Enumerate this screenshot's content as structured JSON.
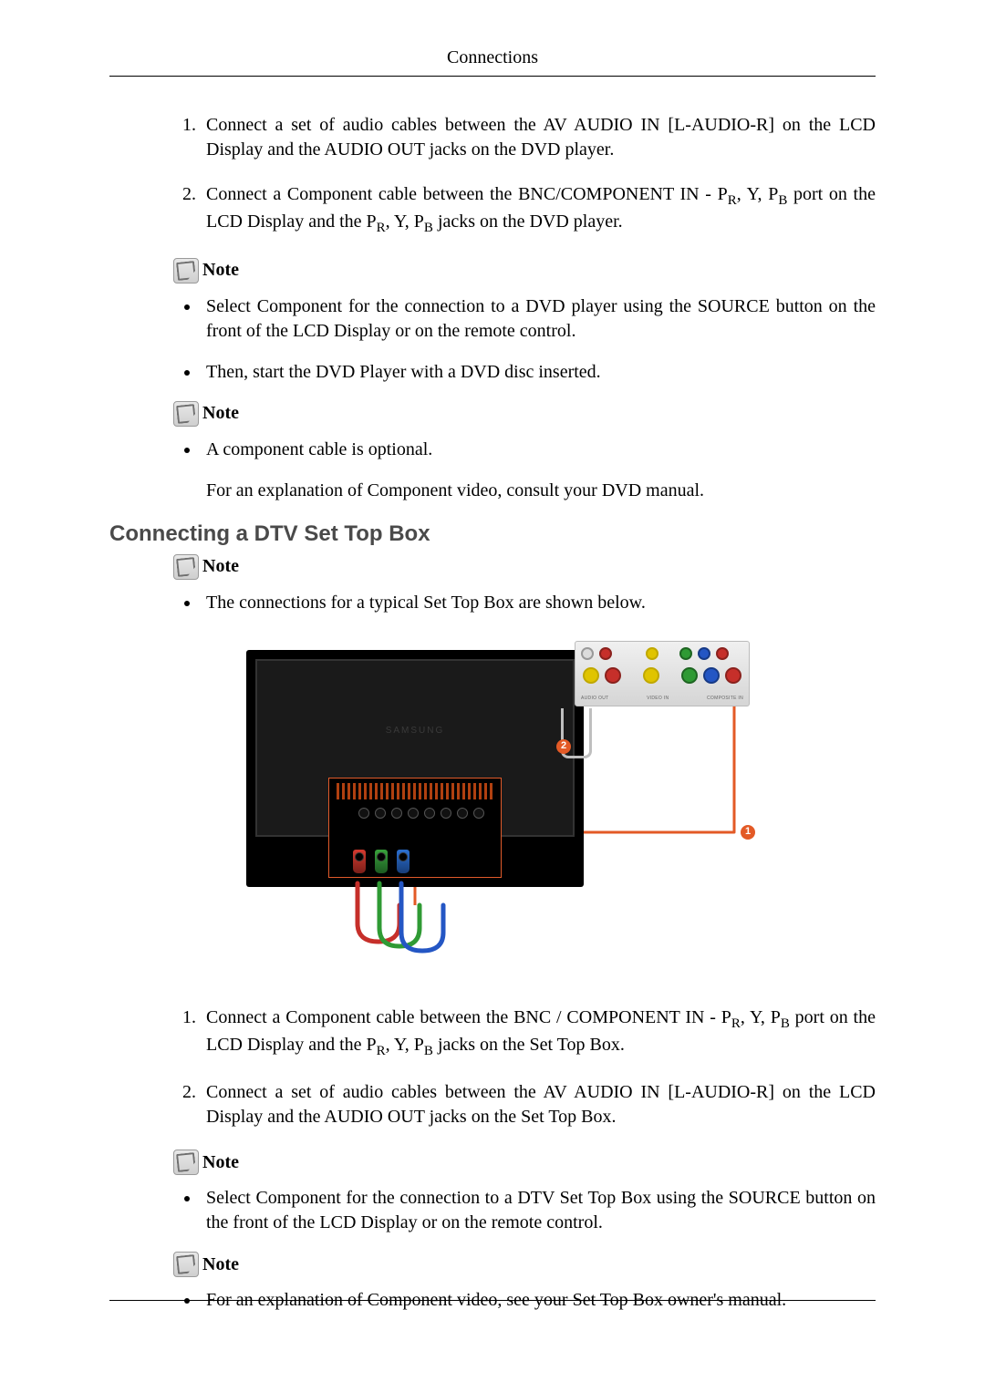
{
  "header": {
    "title": "Connections"
  },
  "section1": {
    "steps": [
      "Connect a set of audio cables between the AV AUDIO IN [L-AUDIO-R] on the LCD Display and the AUDIO OUT jacks on the DVD player.",
      "Connect a Component cable between the BNC/COMPONENT IN - P<sub>R</sub>, Y, P<sub>B</sub> port on the LCD Display and the P<sub>R</sub>, Y, P<sub>B</sub> jacks on the DVD player."
    ],
    "note1_label": "Note",
    "note1_bullets": [
      "Select Component for the connection to a DVD player using the SOURCE button on the front of the LCD Display or on the remote control.",
      "Then, start the DVD Player with a DVD disc inserted."
    ],
    "note2_label": "Note",
    "note2_bullets": [
      "A component cable is optional."
    ],
    "note2_after": "For an explanation of Component video, consult your DVD manual."
  },
  "section2": {
    "heading": "Connecting a DTV Set Top Box",
    "note1_label": "Note",
    "note1_bullets": [
      "The connections for a typical Set Top Box are shown below."
    ],
    "diagram": {
      "tv_brand": "SAMSUNG",
      "stb_labels": [
        "AUDIO OUT",
        "VIDEO IN",
        "COMPOSITE IN"
      ],
      "badge1": "1",
      "badge2": "2"
    },
    "steps": [
      "Connect a Component cable between the BNC / COMPONENT IN - P<sub>R</sub>, Y, P<sub>B</sub> port on the LCD Display and the P<sub>R</sub>, Y, P<sub>B</sub> jacks on the Set Top Box.",
      "Connect a set of audio cables between the AV AUDIO IN [L-AUDIO-R] on the LCD Display and the AUDIO OUT jacks on the Set Top Box."
    ],
    "note2_label": "Note",
    "note2_bullets": [
      "Select Component for the connection to a DTV Set Top Box using the SOURCE button on the front of the LCD Display or on the remote control."
    ],
    "note3_label": "Note",
    "note3_bullets": [
      "For an explanation of Component video, see your Set Top Box owner's manual."
    ]
  }
}
